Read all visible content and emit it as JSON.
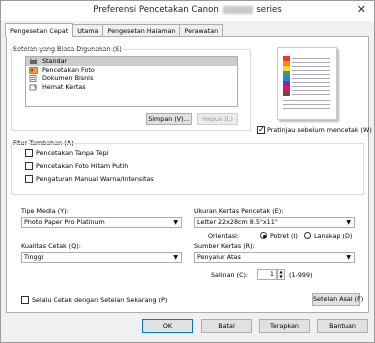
{
  "window": {
    "title_prefix": "Preferensi Pencetakan Canon",
    "title_suffix": "series",
    "close_glyph": "✕"
  },
  "tabs": [
    {
      "label": "Pengesetan Cepat",
      "active": true
    },
    {
      "label": "Utama"
    },
    {
      "label": "Pengesetan Halaman"
    },
    {
      "label": "Perawatan"
    }
  ],
  "common_settings": {
    "label": "Setelan yang Biasa Digunakan (S)",
    "items": [
      {
        "label": "Standar",
        "selected": true,
        "icon": "printer-icon"
      },
      {
        "label": "Pencetakan Foto",
        "icon": "photo-icon"
      },
      {
        "label": "Dokumen Bisnis",
        "icon": "document-icon"
      },
      {
        "label": "Hemat Kertas",
        "icon": "paper-saving-icon"
      }
    ],
    "save_button": "Simpan (V)...",
    "delete_button": "Hapus (L)"
  },
  "preview": {
    "checkbox_label": "Pratinjau sebelum mencetak (W)",
    "checked": true
  },
  "additional_features": {
    "label": "Fitur Tambahan (A)",
    "items": [
      {
        "label": "Pencetakan Tanpa Tepi",
        "checked": false
      },
      {
        "label": "Pencetakan Foto Hitam Putih",
        "checked": false
      },
      {
        "label": "Pengaturan Manual Warna/Intensitas",
        "checked": false
      }
    ]
  },
  "media_type": {
    "label": "Tipe Media (Y):",
    "value": "Photo Paper Pro Platinum"
  },
  "print_paper_size": {
    "label": "Ukuran Kertas Pencetak (E):",
    "value": "Letter 22x28cm 8.5\"x11\""
  },
  "orientation": {
    "label": "Orientasi:",
    "portrait": "Potret (I)",
    "landscape": "Lanskap (D)",
    "selected": "portrait"
  },
  "print_quality": {
    "label": "Kualitas Cetak (Q):",
    "value": "Tinggi"
  },
  "paper_source": {
    "label": "Sumber Kertas (R):",
    "value": "Penyalur Atas"
  },
  "copies": {
    "label": "Salinan (C):",
    "value": "1",
    "range": "(1-999)"
  },
  "always_print": {
    "label": "Selalu Cetak dengan Setelan Sekarang (P)",
    "checked": false
  },
  "defaults_button": "Setelan Asal (F)",
  "footer": {
    "ok": "OK",
    "cancel": "Batal",
    "apply": "Terapkan",
    "help": "Bantuan"
  }
}
